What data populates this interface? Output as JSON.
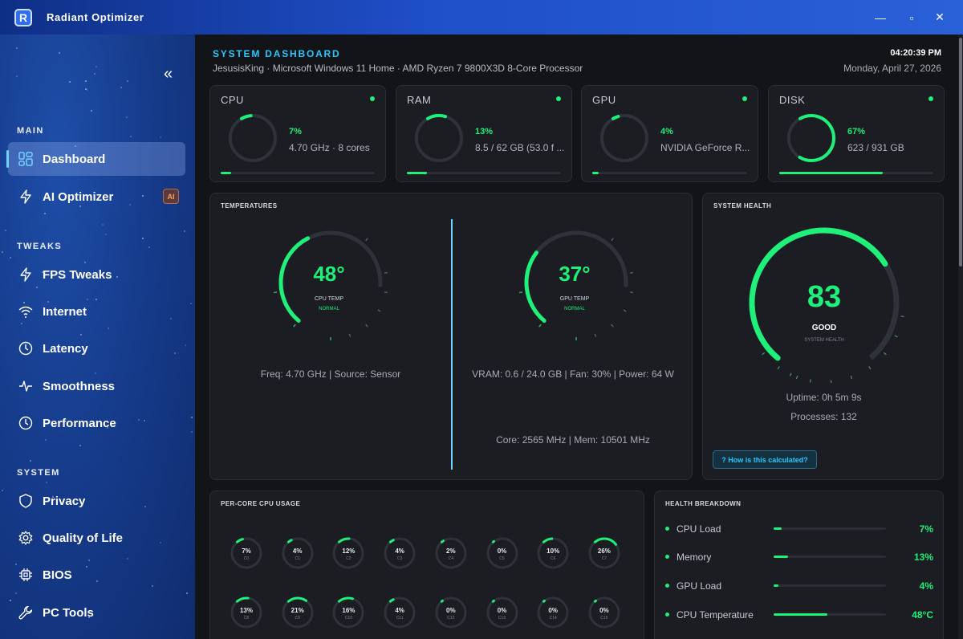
{
  "app": {
    "title": "Radiant Optimizer",
    "logo_letter": "R"
  },
  "window": {
    "minimize": "—",
    "restore": "▫",
    "close": "✕"
  },
  "sidebar": {
    "collapse_label": "«",
    "sections": [
      {
        "label": "MAIN"
      },
      {
        "label": "TWEAKS"
      },
      {
        "label": "SYSTEM"
      }
    ],
    "items": [
      {
        "label": "Dashboard",
        "icon": "dashboard-icon"
      },
      {
        "label": "AI Optimizer",
        "icon": "bolt-icon",
        "badge": "AI"
      },
      {
        "label": "FPS Tweaks",
        "icon": "bolt-icon"
      },
      {
        "label": "Internet",
        "icon": "wifi-icon"
      },
      {
        "label": "Latency",
        "icon": "clock-icon"
      },
      {
        "label": "Smoothness",
        "icon": "pulse-icon"
      },
      {
        "label": "Performance",
        "icon": "clock-icon"
      },
      {
        "label": "Privacy",
        "icon": "shield-icon"
      },
      {
        "label": "Quality of Life",
        "icon": "gear-icon"
      },
      {
        "label": "BIOS",
        "icon": "chip-icon"
      },
      {
        "label": "PC Tools",
        "icon": "wrench-icon"
      }
    ]
  },
  "header": {
    "title": "SYSTEM DASHBOARD",
    "subtitle": "JesusisKing  ·  Microsoft Windows 11 Home  ·  AMD Ryzen 7 9800X3D 8-Core Processor",
    "time": "04:20:39 PM",
    "date": "Monday, April 27, 2026"
  },
  "stats": [
    {
      "title": "CPU",
      "pct": "7%",
      "detail": "4.70 GHz  ·  8 cores",
      "value": 0.07
    },
    {
      "title": "RAM",
      "pct": "13%",
      "detail": "8.5 / 62 GB  (53.0 f ...",
      "value": 0.13
    },
    {
      "title": "GPU",
      "pct": "4%",
      "detail": "NVIDIA GeForce R...",
      "value": 0.04
    },
    {
      "title": "DISK",
      "pct": "67%",
      "detail": "623 / 931 GB",
      "value": 0.67
    }
  ],
  "temperatures": {
    "heading": "TEMPERATURES",
    "cpu": {
      "value": "48°",
      "label": "CPU TEMP",
      "status": "NORMAL",
      "info": "Freq: 4.70 GHz  |  Source: Sensor",
      "level": 0.48
    },
    "gpu": {
      "value": "37°",
      "label": "GPU TEMP",
      "status": "NORMAL",
      "info": "VRAM: 0.6 / 24.0 GB  |  Fan: 30%  |  Power: 64 W",
      "info2": "Core: 2565 MHz  |  Mem: 10501 MHz",
      "level": 0.37
    }
  },
  "health": {
    "heading": "SYSTEM HEALTH",
    "score": "83",
    "status": "GOOD",
    "sub": "SYSTEM HEALTH",
    "level": 0.83,
    "uptime": "Uptime: 0h 5m 9s",
    "processes": "Processes: 132",
    "how_label": "?  How is this calculated?"
  },
  "per_core": {
    "heading": "PER-CORE CPU USAGE",
    "cores": [
      {
        "name": "C0",
        "pct": "7%",
        "value": 0.07
      },
      {
        "name": "C1",
        "pct": "4%",
        "value": 0.04
      },
      {
        "name": "C2",
        "pct": "12%",
        "value": 0.12
      },
      {
        "name": "C3",
        "pct": "4%",
        "value": 0.04
      },
      {
        "name": "C4",
        "pct": "2%",
        "value": 0.02
      },
      {
        "name": "C5",
        "pct": "0%",
        "value": 0.0
      },
      {
        "name": "C6",
        "pct": "10%",
        "value": 0.1
      },
      {
        "name": "C7",
        "pct": "26%",
        "value": 0.26
      },
      {
        "name": "C8",
        "pct": "13%",
        "value": 0.13
      },
      {
        "name": "C9",
        "pct": "21%",
        "value": 0.21
      },
      {
        "name": "C10",
        "pct": "16%",
        "value": 0.16
      },
      {
        "name": "C11",
        "pct": "4%",
        "value": 0.04
      },
      {
        "name": "C12",
        "pct": "0%",
        "value": 0.0
      },
      {
        "name": "C13",
        "pct": "0%",
        "value": 0.0
      },
      {
        "name": "C14",
        "pct": "0%",
        "value": 0.0
      },
      {
        "name": "C15",
        "pct": "0%",
        "value": 0.0
      }
    ]
  },
  "breakdown": {
    "heading": "HEALTH BREAKDOWN",
    "rows": [
      {
        "name": "CPU Load",
        "val": "7%",
        "value": 0.07
      },
      {
        "name": "Memory",
        "val": "13%",
        "value": 0.13
      },
      {
        "name": "GPU Load",
        "val": "4%",
        "value": 0.04
      },
      {
        "name": "CPU Temperature",
        "val": "48°C",
        "value": 0.48
      }
    ]
  },
  "colors": {
    "accent": "#1ef07a",
    "title_accent": "#29c7ff",
    "card": "#1b1d22",
    "sidebar": "#163c8c"
  }
}
